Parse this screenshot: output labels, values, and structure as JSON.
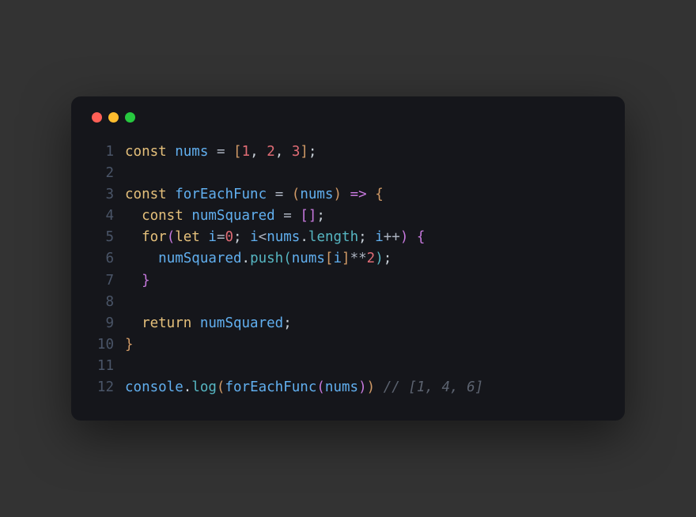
{
  "window": {
    "traffic_lights": [
      "red",
      "yellow",
      "green"
    ]
  },
  "code": {
    "lines": [
      {
        "n": "1",
        "tokens": [
          {
            "c": "c-key",
            "t": "const"
          },
          {
            "c": "c-def",
            "t": " "
          },
          {
            "c": "c-fn",
            "t": "nums"
          },
          {
            "c": "c-def",
            "t": " "
          },
          {
            "c": "c-op",
            "t": "="
          },
          {
            "c": "c-def",
            "t": " "
          },
          {
            "c": "c-br1",
            "t": "["
          },
          {
            "c": "c-num",
            "t": "1"
          },
          {
            "c": "c-def",
            "t": ", "
          },
          {
            "c": "c-num",
            "t": "2"
          },
          {
            "c": "c-def",
            "t": ", "
          },
          {
            "c": "c-num",
            "t": "3"
          },
          {
            "c": "c-br1",
            "t": "]"
          },
          {
            "c": "c-def",
            "t": ";"
          }
        ]
      },
      {
        "n": "2",
        "tokens": []
      },
      {
        "n": "3",
        "tokens": [
          {
            "c": "c-key",
            "t": "const"
          },
          {
            "c": "c-def",
            "t": " "
          },
          {
            "c": "c-fn",
            "t": "forEachFunc"
          },
          {
            "c": "c-def",
            "t": " "
          },
          {
            "c": "c-op",
            "t": "="
          },
          {
            "c": "c-def",
            "t": " "
          },
          {
            "c": "c-br1",
            "t": "("
          },
          {
            "c": "c-fn",
            "t": "nums"
          },
          {
            "c": "c-br1",
            "t": ")"
          },
          {
            "c": "c-def",
            "t": " "
          },
          {
            "c": "c-arrow",
            "t": "=>"
          },
          {
            "c": "c-def",
            "t": " "
          },
          {
            "c": "c-br1",
            "t": "{"
          }
        ]
      },
      {
        "n": "4",
        "tokens": [
          {
            "c": "c-def",
            "t": "  "
          },
          {
            "c": "c-key",
            "t": "const"
          },
          {
            "c": "c-def",
            "t": " "
          },
          {
            "c": "c-fn",
            "t": "numSquared"
          },
          {
            "c": "c-def",
            "t": " "
          },
          {
            "c": "c-op",
            "t": "="
          },
          {
            "c": "c-def",
            "t": " "
          },
          {
            "c": "c-br2",
            "t": "["
          },
          {
            "c": "c-br2",
            "t": "]"
          },
          {
            "c": "c-def",
            "t": ";"
          }
        ]
      },
      {
        "n": "5",
        "tokens": [
          {
            "c": "c-def",
            "t": "  "
          },
          {
            "c": "c-key",
            "t": "for"
          },
          {
            "c": "c-br2",
            "t": "("
          },
          {
            "c": "c-key",
            "t": "let"
          },
          {
            "c": "c-def",
            "t": " "
          },
          {
            "c": "c-fn",
            "t": "i"
          },
          {
            "c": "c-op",
            "t": "="
          },
          {
            "c": "c-num",
            "t": "0"
          },
          {
            "c": "c-def",
            "t": "; "
          },
          {
            "c": "c-fn",
            "t": "i"
          },
          {
            "c": "c-op",
            "t": "<"
          },
          {
            "c": "c-fn",
            "t": "nums"
          },
          {
            "c": "c-def",
            "t": "."
          },
          {
            "c": "c-prop",
            "t": "length"
          },
          {
            "c": "c-def",
            "t": "; "
          },
          {
            "c": "c-fn",
            "t": "i"
          },
          {
            "c": "c-op",
            "t": "++"
          },
          {
            "c": "c-br2",
            "t": ")"
          },
          {
            "c": "c-def",
            "t": " "
          },
          {
            "c": "c-br2",
            "t": "{"
          }
        ]
      },
      {
        "n": "6",
        "tokens": [
          {
            "c": "c-def",
            "t": "    "
          },
          {
            "c": "c-fn",
            "t": "numSquared"
          },
          {
            "c": "c-def",
            "t": "."
          },
          {
            "c": "c-prop",
            "t": "push"
          },
          {
            "c": "c-br3",
            "t": "("
          },
          {
            "c": "c-fn",
            "t": "nums"
          },
          {
            "c": "c-br1",
            "t": "["
          },
          {
            "c": "c-fn",
            "t": "i"
          },
          {
            "c": "c-br1",
            "t": "]"
          },
          {
            "c": "c-op",
            "t": "**"
          },
          {
            "c": "c-num",
            "t": "2"
          },
          {
            "c": "c-br3",
            "t": ")"
          },
          {
            "c": "c-def",
            "t": ";"
          }
        ]
      },
      {
        "n": "7",
        "tokens": [
          {
            "c": "c-def",
            "t": "  "
          },
          {
            "c": "c-br2",
            "t": "}"
          }
        ]
      },
      {
        "n": "8",
        "tokens": []
      },
      {
        "n": "9",
        "tokens": [
          {
            "c": "c-def",
            "t": "  "
          },
          {
            "c": "c-key",
            "t": "return"
          },
          {
            "c": "c-def",
            "t": " "
          },
          {
            "c": "c-fn",
            "t": "numSquared"
          },
          {
            "c": "c-def",
            "t": ";"
          }
        ]
      },
      {
        "n": "10",
        "tokens": [
          {
            "c": "c-br1",
            "t": "}"
          }
        ]
      },
      {
        "n": "11",
        "tokens": []
      },
      {
        "n": "12",
        "tokens": [
          {
            "c": "c-fn",
            "t": "console"
          },
          {
            "c": "c-def",
            "t": "."
          },
          {
            "c": "c-prop",
            "t": "log"
          },
          {
            "c": "c-br1",
            "t": "("
          },
          {
            "c": "c-fn",
            "t": "forEachFunc"
          },
          {
            "c": "c-br2",
            "t": "("
          },
          {
            "c": "c-fn",
            "t": "nums"
          },
          {
            "c": "c-br2",
            "t": ")"
          },
          {
            "c": "c-br1",
            "t": ")"
          },
          {
            "c": "c-def",
            "t": " "
          },
          {
            "c": "c-comm",
            "t": "// [1, 4, 6]"
          }
        ]
      }
    ]
  }
}
